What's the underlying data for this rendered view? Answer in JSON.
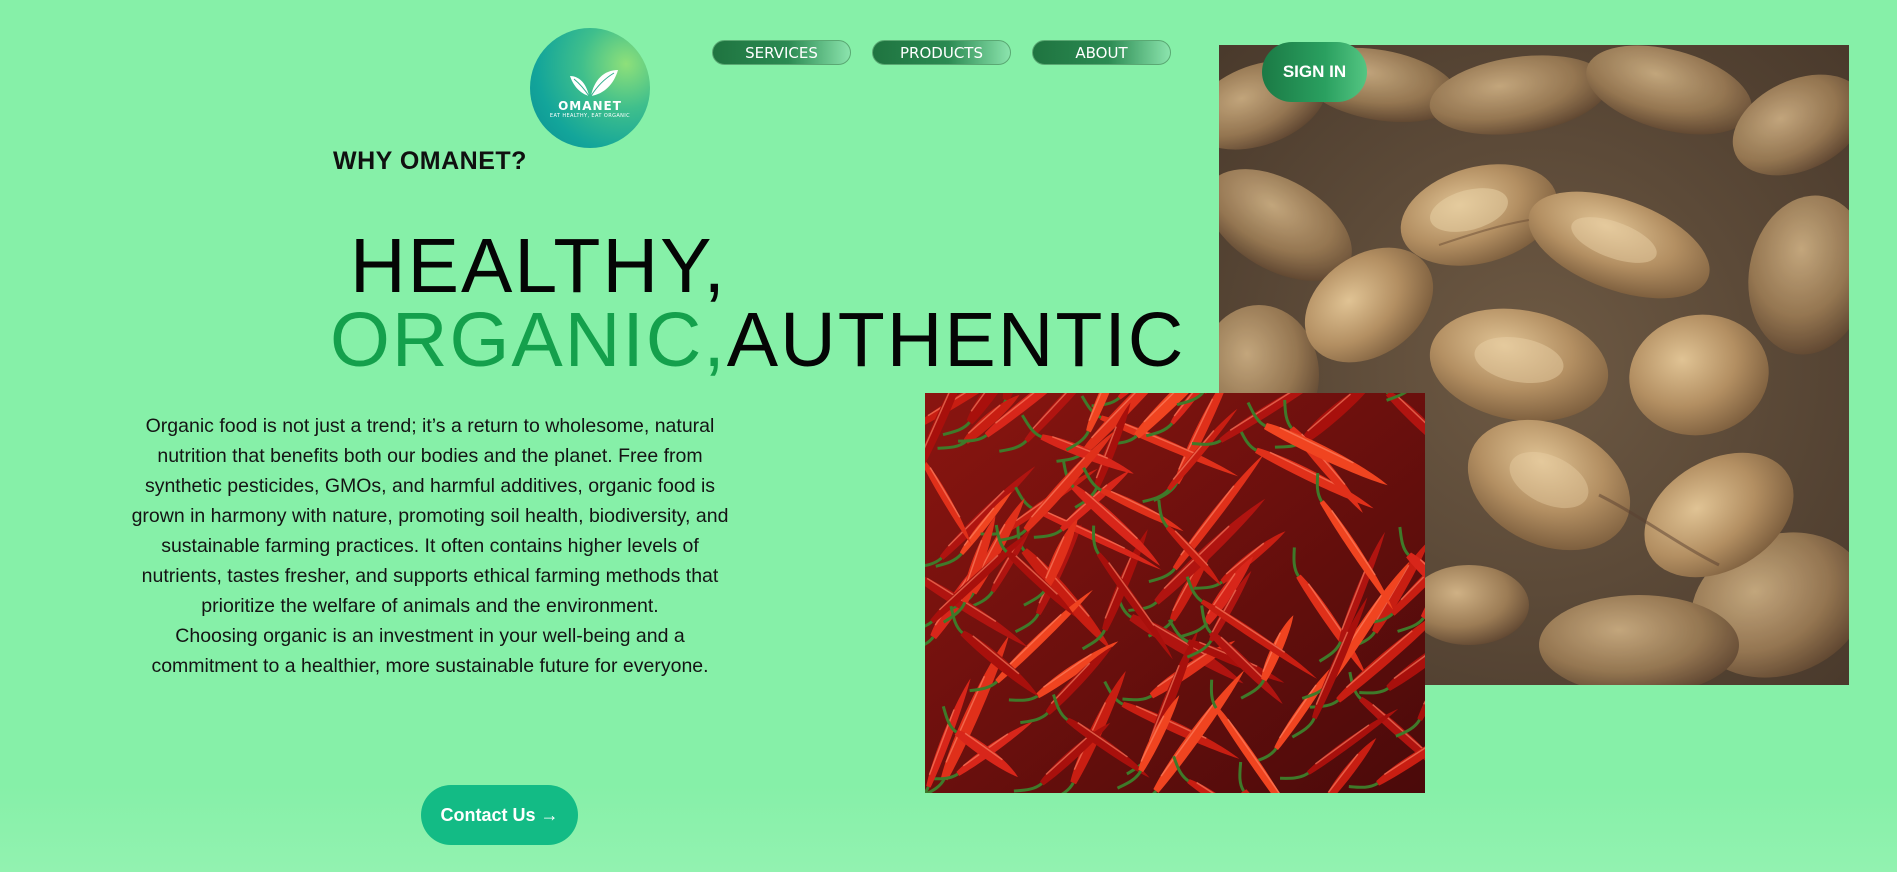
{
  "logo": {
    "name": "OMANET",
    "tagline": "EAT HEALTHY, EAT ORGANIC"
  },
  "nav": {
    "items": [
      {
        "label": "SERVICES"
      },
      {
        "label": "PRODUCTS"
      },
      {
        "label": "ABOUT"
      }
    ]
  },
  "header": {
    "signin_label": "SIGN IN"
  },
  "main": {
    "why_title": "WHY OMANET?",
    "headline_line1": "HEALTHY,",
    "headline_organic": "ORGANIC,",
    "headline_authentic": "AUTHENTIC",
    "paragraph1": "Organic food is not just a trend; it’s a return to wholesome, natural nutrition that benefits both our bodies and the planet. Free from synthetic pesticides, GMOs, and harmful additives, organic food is grown in harmony with nature, promoting soil health, biodiversity, and sustainable farming practices. It often contains higher levels of nutrients, tastes fresher, and supports ethical farming methods that prioritize the welfare of animals and the environment.",
    "paragraph2": "Choosing organic is an investment in your well-being and a commitment to a healthier, more sustainable future for everyone.",
    "contact_label": "Contact Us →"
  },
  "colors": {
    "background": "#86f0a8",
    "accent_green": "#14a04c",
    "button_teal": "#13bb85",
    "nav_dark_green": "#1f7440"
  },
  "icons": {
    "logo": "leaf-icon",
    "contact_arrow": "arrow-right-icon"
  }
}
